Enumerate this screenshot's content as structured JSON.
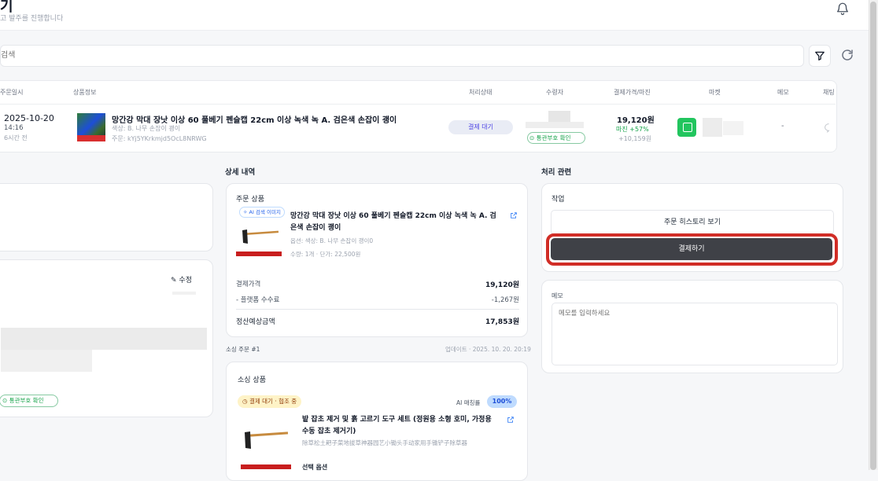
{
  "header": {
    "title": "기",
    "subtitle": "고 발주를 진행합니다"
  },
  "search": {
    "placeholder": "검색"
  },
  "table": {
    "columns": [
      "주문일시",
      "상품정보",
      "처리상태",
      "수령자",
      "결제가격/마진",
      "마켓",
      "메모",
      "채팅"
    ],
    "row": {
      "date": "2025-10-20",
      "time": "14:16",
      "ago": "6시간 전",
      "product_name": "망간강 막대 장낫 이상 60 풀베기 펜슬캡 22cm 이상 녹색 녹 A. 검은색 손잡이 괭이",
      "option": "색상: B. 나무 손잡이 괭이",
      "order_no": "주문: kYj5YKrkmjd5OcL8NRWG",
      "status": "결제 대기",
      "customs_badge": "통관부호 확인",
      "price": "19,120원",
      "margin": "마진 +57%",
      "margin_amount": "+10,159원",
      "memo": "-"
    }
  },
  "left_panel": {
    "edit_label": "수정",
    "customs_badge": "통관부호 확인"
  },
  "detail": {
    "section_title": "상세 내역",
    "order_product": {
      "title": "주문 상품",
      "ai_badge": "AI 검색 이미지",
      "name": "망간강 막대 장낫 이상 60 풀베기 펜슬캡 22cm 이상 녹색 녹 A. 검은색 손잡이 괭이",
      "option": "옵션: 색상: B. 나무 손잡이 괭이0",
      "qty_price": "수량: 1개 · 단가: 22,500원",
      "pay_label": "결제가격",
      "pay_value": "19,120원",
      "fee_label": "- 플랫폼 수수료",
      "fee_value": "-1,267원",
      "settle_label": "정산예상금액",
      "settle_value": "17,853원"
    },
    "sourcing": {
      "header": "소싱 주문 #1",
      "updated": "업데이트 · 2025. 10. 20. 20:19",
      "title": "소싱 상품",
      "status_badge": "결제 대기 · 협조 중",
      "ai_match_label": "AI 매칭률",
      "ai_match_value": "100%",
      "name": "밭 잡초 제거 및 흙 고르기 도구 세트 (정원용 소형 호미, 가정용 수동 잡초 제거기)",
      "original_name": "除草松土耙子菜地拔草神器园艺小锄头手动家用手锄铲子除草器",
      "option_label": "선택 옵션"
    }
  },
  "processing": {
    "section_title": "처리 관련",
    "actions_title": "작업",
    "history_button": "주문 히스토리 보기",
    "pay_button": "결제하기",
    "memo_title": "메모",
    "memo_placeholder": "메모를 입력하세요"
  },
  "colors": {
    "accent_green": "#16a34a",
    "primary_dark": "#3f4147",
    "highlight_red": "#d12d26",
    "market_green": "#22c55e"
  }
}
